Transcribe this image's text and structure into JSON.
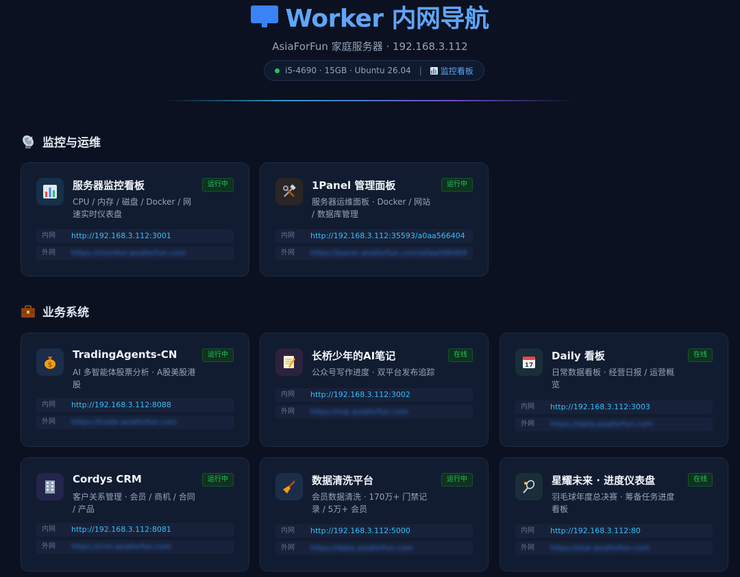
{
  "header": {
    "title": "Worker 内网导航",
    "subtitle": "AsiaForFun 家庭服务器 · 192.168.3.112",
    "specs": "i5-4690 · 15GB · Ubuntu 26.04",
    "separator": "|",
    "monitor_link": "监控看板"
  },
  "sections": [
    {
      "title": "监控与运维",
      "icon": "satellite-dish-icon"
    },
    {
      "title": "业务系统",
      "icon": "briefcase-icon"
    }
  ],
  "labels": {
    "internal": "内网",
    "external": "外网"
  },
  "cards": [
    {
      "name": "服务器监控看板",
      "icon": "bar-chart-icon",
      "desc": "CPU / 内存 / 磁盘 / Docker / 网速实时仪表盘",
      "badge": "运行中",
      "internal": "http://192.168.3.112:3001",
      "external": "https://monitor.asiaforfun.com"
    },
    {
      "name": "1Panel 管理面板",
      "icon": "hammer-wrench-icon",
      "desc": "服务器运维面板 · Docker / 网站 / 数据库管理",
      "badge": "运行中",
      "internal": "http://192.168.3.112:35593/a0aa566404",
      "external": "https://panel.asiaforfun.com/a0aa566404"
    },
    {
      "name": "TradingAgents-CN",
      "icon": "money-bag-icon",
      "desc": "AI 多智能体股票分析 · A股美股港股",
      "badge": "运行中",
      "internal": "http://192.168.3.112:8088",
      "external": "https://trade.asiaforfun.com"
    },
    {
      "name": "长桥少年的AI笔记",
      "icon": "memo-icon",
      "desc": "公众号写作进度 · 双平台发布追踪",
      "badge": "在线",
      "internal": "http://192.168.3.112:3002",
      "external": "https://mp.asiaforfun.com"
    },
    {
      "name": "Daily 看板",
      "icon": "calendar-icon",
      "desc": "日常数据看板 · 经营日报 / 运营概览",
      "badge": "在线",
      "internal": "http://192.168.3.112:3003",
      "external": "https://daily.asiaforfun.com"
    },
    {
      "name": "Cordys CRM",
      "icon": "office-building-icon",
      "desc": "客户关系管理 · 会员 / 商机 / 合同 / 产品",
      "badge": "运行中",
      "internal": "http://192.168.3.112:8081",
      "external": "https://crm.asiaforfun.com"
    },
    {
      "name": "数据清洗平台",
      "icon": "broom-icon",
      "desc": "会员数据清洗 · 170万+ 门禁记录 / 5万+ 会员",
      "badge": "运行中",
      "internal": "http://192.168.3.112:5000",
      "external": "https://data.asiaforfun.com"
    },
    {
      "name": "星耀未来 · 进度仪表盘",
      "icon": "badminton-icon",
      "desc": "羽毛球年度总决赛 · 筹备任务进度看板",
      "badge": "在线",
      "internal": "http://192.168.3.112:80",
      "external": "https://star.asiaforfun.com"
    }
  ]
}
